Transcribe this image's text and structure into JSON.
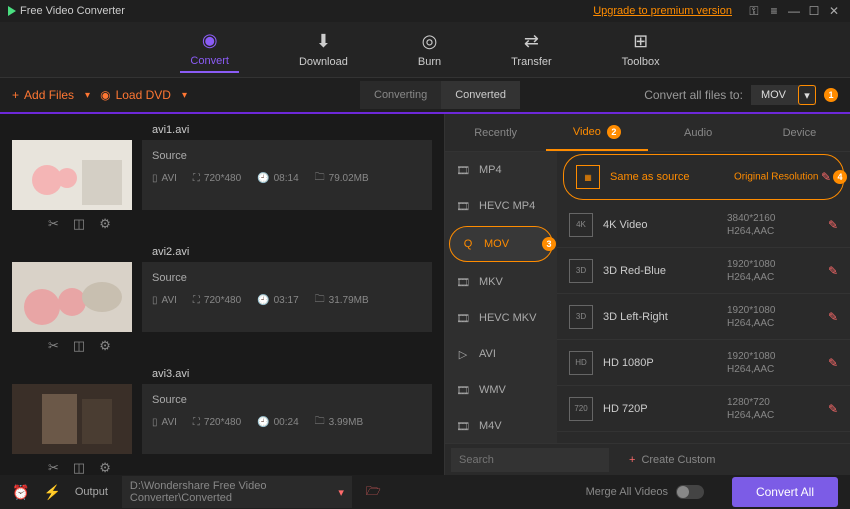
{
  "titlebar": {
    "app_name": "Free Video Converter",
    "upgrade": "Upgrade to premium version"
  },
  "maintabs": [
    {
      "label": "Convert",
      "active": true
    },
    {
      "label": "Download"
    },
    {
      "label": "Burn"
    },
    {
      "label": "Transfer"
    },
    {
      "label": "Toolbox"
    }
  ],
  "toolbar": {
    "add_files": "Add Files",
    "load_dvd": "Load DVD",
    "segtabs": [
      {
        "label": "Converting"
      },
      {
        "label": "Converted",
        "active": true
      }
    ],
    "convert_all_label": "Convert all files to:",
    "format_value": "MOV",
    "badge1": "1"
  },
  "files": [
    {
      "name": "avi1.avi",
      "source": "Source",
      "fmt": "AVI",
      "res": "720*480",
      "dur": "08:14",
      "size": "79.02MB"
    },
    {
      "name": "avi2.avi",
      "source": "Source",
      "fmt": "AVI",
      "res": "720*480",
      "dur": "03:17",
      "size": "31.79MB"
    },
    {
      "name": "avi3.avi",
      "source": "Source",
      "fmt": "AVI",
      "res": "720*480",
      "dur": "00:24",
      "size": "3.99MB"
    }
  ],
  "panel": {
    "tabs": [
      {
        "label": "Recently"
      },
      {
        "label": "Video",
        "active": true,
        "badge": "2"
      },
      {
        "label": "Audio"
      },
      {
        "label": "Device"
      }
    ],
    "formats": [
      {
        "label": "MP4"
      },
      {
        "label": "HEVC MP4"
      },
      {
        "label": "MOV",
        "active": true,
        "badge": "3"
      },
      {
        "label": "MKV"
      },
      {
        "label": "HEVC MKV"
      },
      {
        "label": "AVI"
      },
      {
        "label": "WMV"
      },
      {
        "label": "M4V"
      }
    ],
    "resolutions": [
      {
        "name": "Same as source",
        "detail": "Original Resolution",
        "active": true,
        "badge": "4",
        "icon": "source"
      },
      {
        "name": "4K Video",
        "detail": "3840*2160\nH264,AAC",
        "icon": "4K"
      },
      {
        "name": "3D Red-Blue",
        "detail": "1920*1080\nH264,AAC",
        "icon": "3D RB"
      },
      {
        "name": "3D Left-Right",
        "detail": "1920*1080\nH264,AAC",
        "icon": "3D LR"
      },
      {
        "name": "HD 1080P",
        "detail": "1920*1080\nH264,AAC",
        "icon": "1080"
      },
      {
        "name": "HD 720P",
        "detail": "1280*720\nH264,AAC",
        "icon": "720"
      }
    ],
    "search_placeholder": "Search",
    "create_custom": "Create Custom"
  },
  "footer": {
    "output_label": "Output",
    "output_path": "D:\\Wondershare Free Video Converter\\Converted",
    "merge_label": "Merge All Videos",
    "convert_all": "Convert All"
  }
}
